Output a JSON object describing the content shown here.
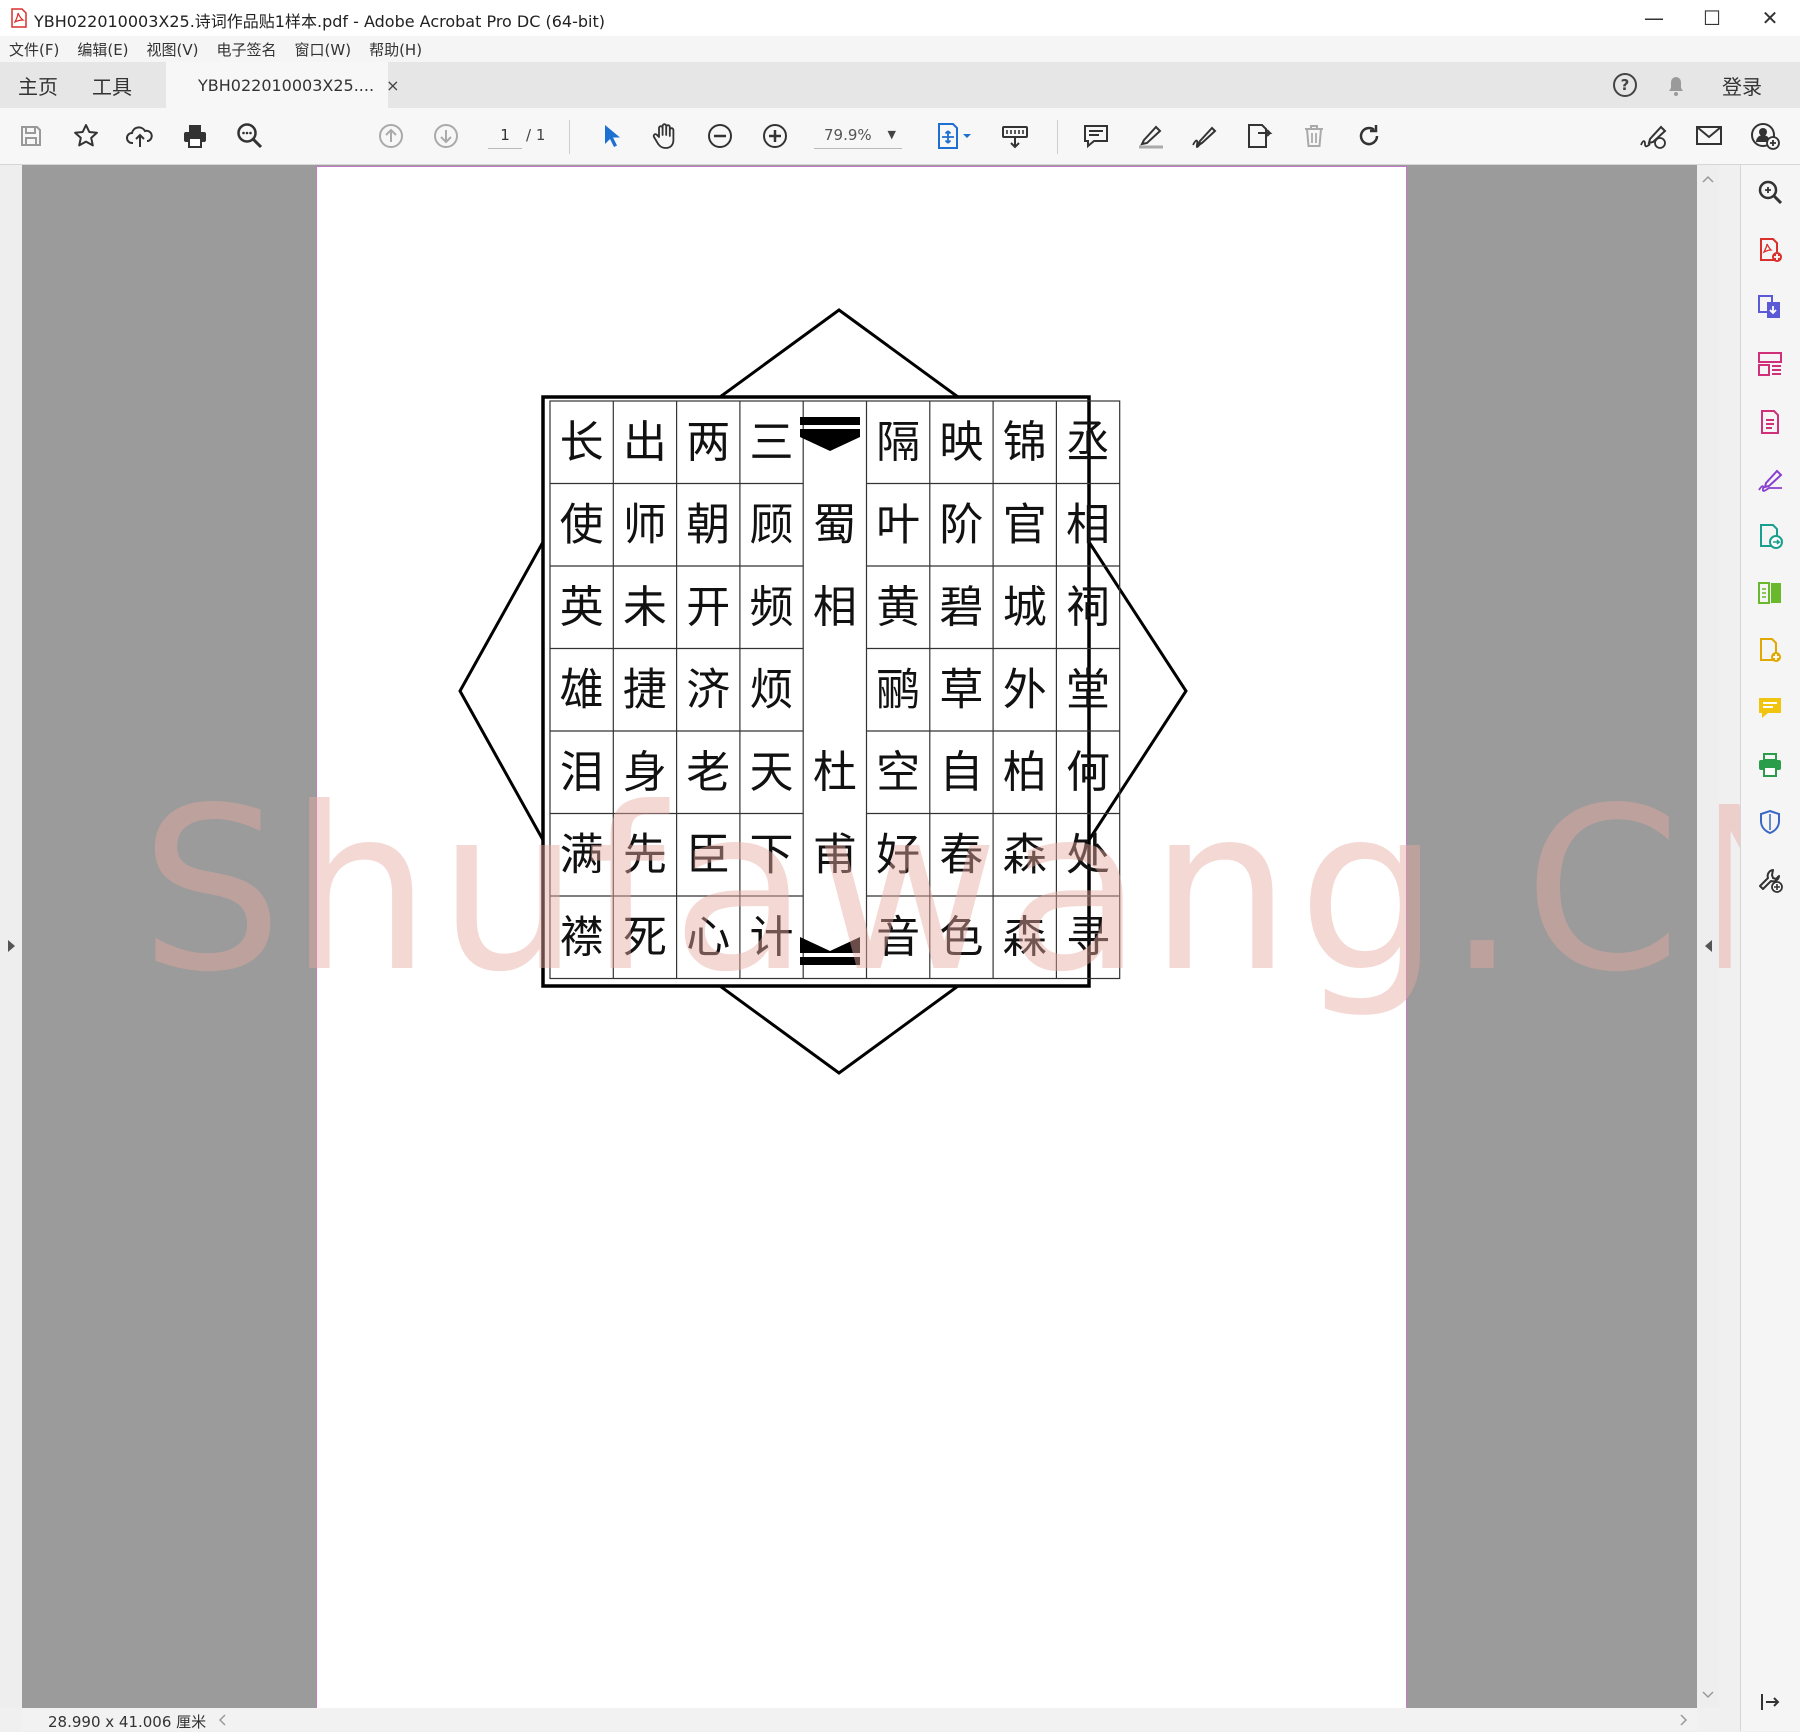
{
  "window": {
    "title": "YBH022010003X25.诗词作品贴1样本.pdf - Adobe Acrobat Pro DC (64-bit)",
    "minimize_glyph": "—",
    "maximize_glyph": "☐",
    "close_glyph": "✕"
  },
  "menu": [
    "文件(F)",
    "编辑(E)",
    "视图(V)",
    "电子签名",
    "窗口(W)",
    "帮助(H)"
  ],
  "tabs": {
    "home": "主页",
    "tools": "工具",
    "document": "YBH022010003X25....",
    "close_glyph": "×",
    "login": "登录"
  },
  "toolbar": {
    "page_current": "1",
    "page_total": "/ 1",
    "zoom": "79.9%",
    "zoom_dropdown": "▼"
  },
  "status": {
    "page_size": "28.990 x 41.006 厘米"
  },
  "watermark": "Shufawang.CN",
  "poem": {
    "rows": [
      [
        "长",
        "出",
        "两",
        "三",
        "",
        "隔",
        "映",
        "锦",
        "丞"
      ],
      [
        "使",
        "师",
        "朝",
        "顾",
        "蜀",
        "叶",
        "阶",
        "官",
        "相"
      ],
      [
        "英",
        "未",
        "开",
        "频",
        "相",
        "黄",
        "碧",
        "城",
        "祠"
      ],
      [
        "雄",
        "捷",
        "济",
        "烦",
        "",
        "鹂",
        "草",
        "外",
        "堂"
      ],
      [
        "泪",
        "身",
        "老",
        "天",
        "杜",
        "空",
        "自",
        "柏",
        "何"
      ],
      [
        "满",
        "先",
        "臣",
        "下",
        "甫",
        "好",
        "春",
        "森",
        "处"
      ],
      [
        "襟",
        "死",
        "心",
        "计",
        "",
        "音",
        "色",
        "森",
        "寻"
      ]
    ]
  },
  "colors": {
    "page_border": "#c77ac4",
    "canvas_gray": "#9b9b9b",
    "accent_blue": "#1d6fd1",
    "pdf_red": "#d9302c"
  }
}
